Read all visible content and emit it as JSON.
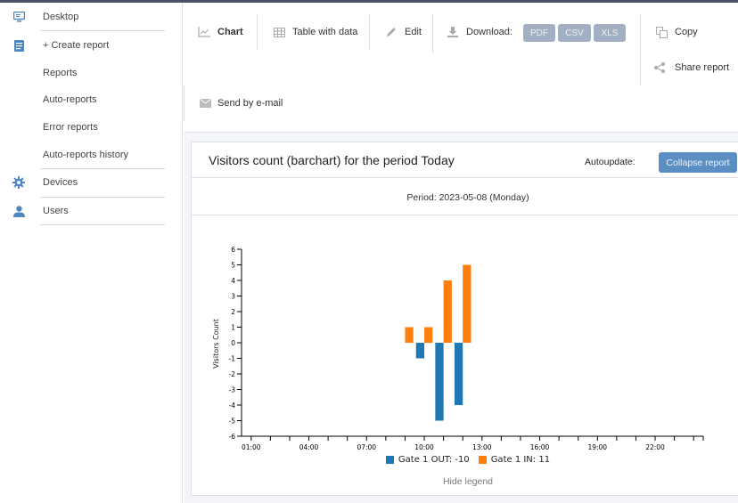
{
  "sidebar": {
    "items": [
      {
        "label": "Desktop",
        "icon": "monitor-icon"
      },
      {
        "label": "+ Create report",
        "icon": "report-icon"
      },
      {
        "label": "Reports"
      },
      {
        "label": "Auto-reports"
      },
      {
        "label": "Error reports"
      },
      {
        "label": "Auto-reports history"
      },
      {
        "label": "Devices",
        "icon": "gear-icon"
      },
      {
        "label": "Users",
        "icon": "user-icon"
      }
    ]
  },
  "toolbar": {
    "chart": "Chart",
    "table": "Table with data",
    "edit": "Edit",
    "download": "Download:",
    "pdf": "PDF",
    "csv": "CSV",
    "xls": "XLS",
    "copy": "Copy",
    "share": "Share report",
    "email": "Send by e-mail"
  },
  "report": {
    "title": "Visitors count (barchart) for the period Today",
    "autoupdate": "Autoupdate:",
    "collapse": "Collapse report",
    "period": "Period: 2023-05-08 (Monday)",
    "hide_legend": "Hide legend"
  },
  "colors": {
    "out": "#1f77b4",
    "in": "#ff7f0e",
    "accent": "#5b8fc4"
  },
  "chart_data": {
    "type": "bar",
    "title": "",
    "xlabel": "",
    "ylabel": "Visitors Count",
    "ylim": [
      -6,
      6
    ],
    "yticks": [
      6,
      5,
      4,
      3,
      2,
      1,
      0,
      -1,
      -2,
      -3,
      -4,
      -5,
      -6
    ],
    "xtick_labels": [
      "01:00",
      "04:00",
      "07:00",
      "10:00",
      "13:00",
      "16:00",
      "19:00",
      "22:00"
    ],
    "x_range_hours": [
      0.5,
      24.5
    ],
    "grid": false,
    "legend_position": "bottom",
    "series": [
      {
        "name": "Gate 1 OUT: -10",
        "color": "#1f77b4",
        "points": [
          {
            "hour": 10,
            "value": -1
          },
          {
            "hour": 11,
            "value": -5
          },
          {
            "hour": 12,
            "value": -4
          }
        ]
      },
      {
        "name": "Gate 1 IN: 11",
        "color": "#ff7f0e",
        "points": [
          {
            "hour": 9,
            "value": 1
          },
          {
            "hour": 10,
            "value": 1
          },
          {
            "hour": 11,
            "value": 4
          },
          {
            "hour": 12,
            "value": 5
          }
        ]
      }
    ]
  }
}
